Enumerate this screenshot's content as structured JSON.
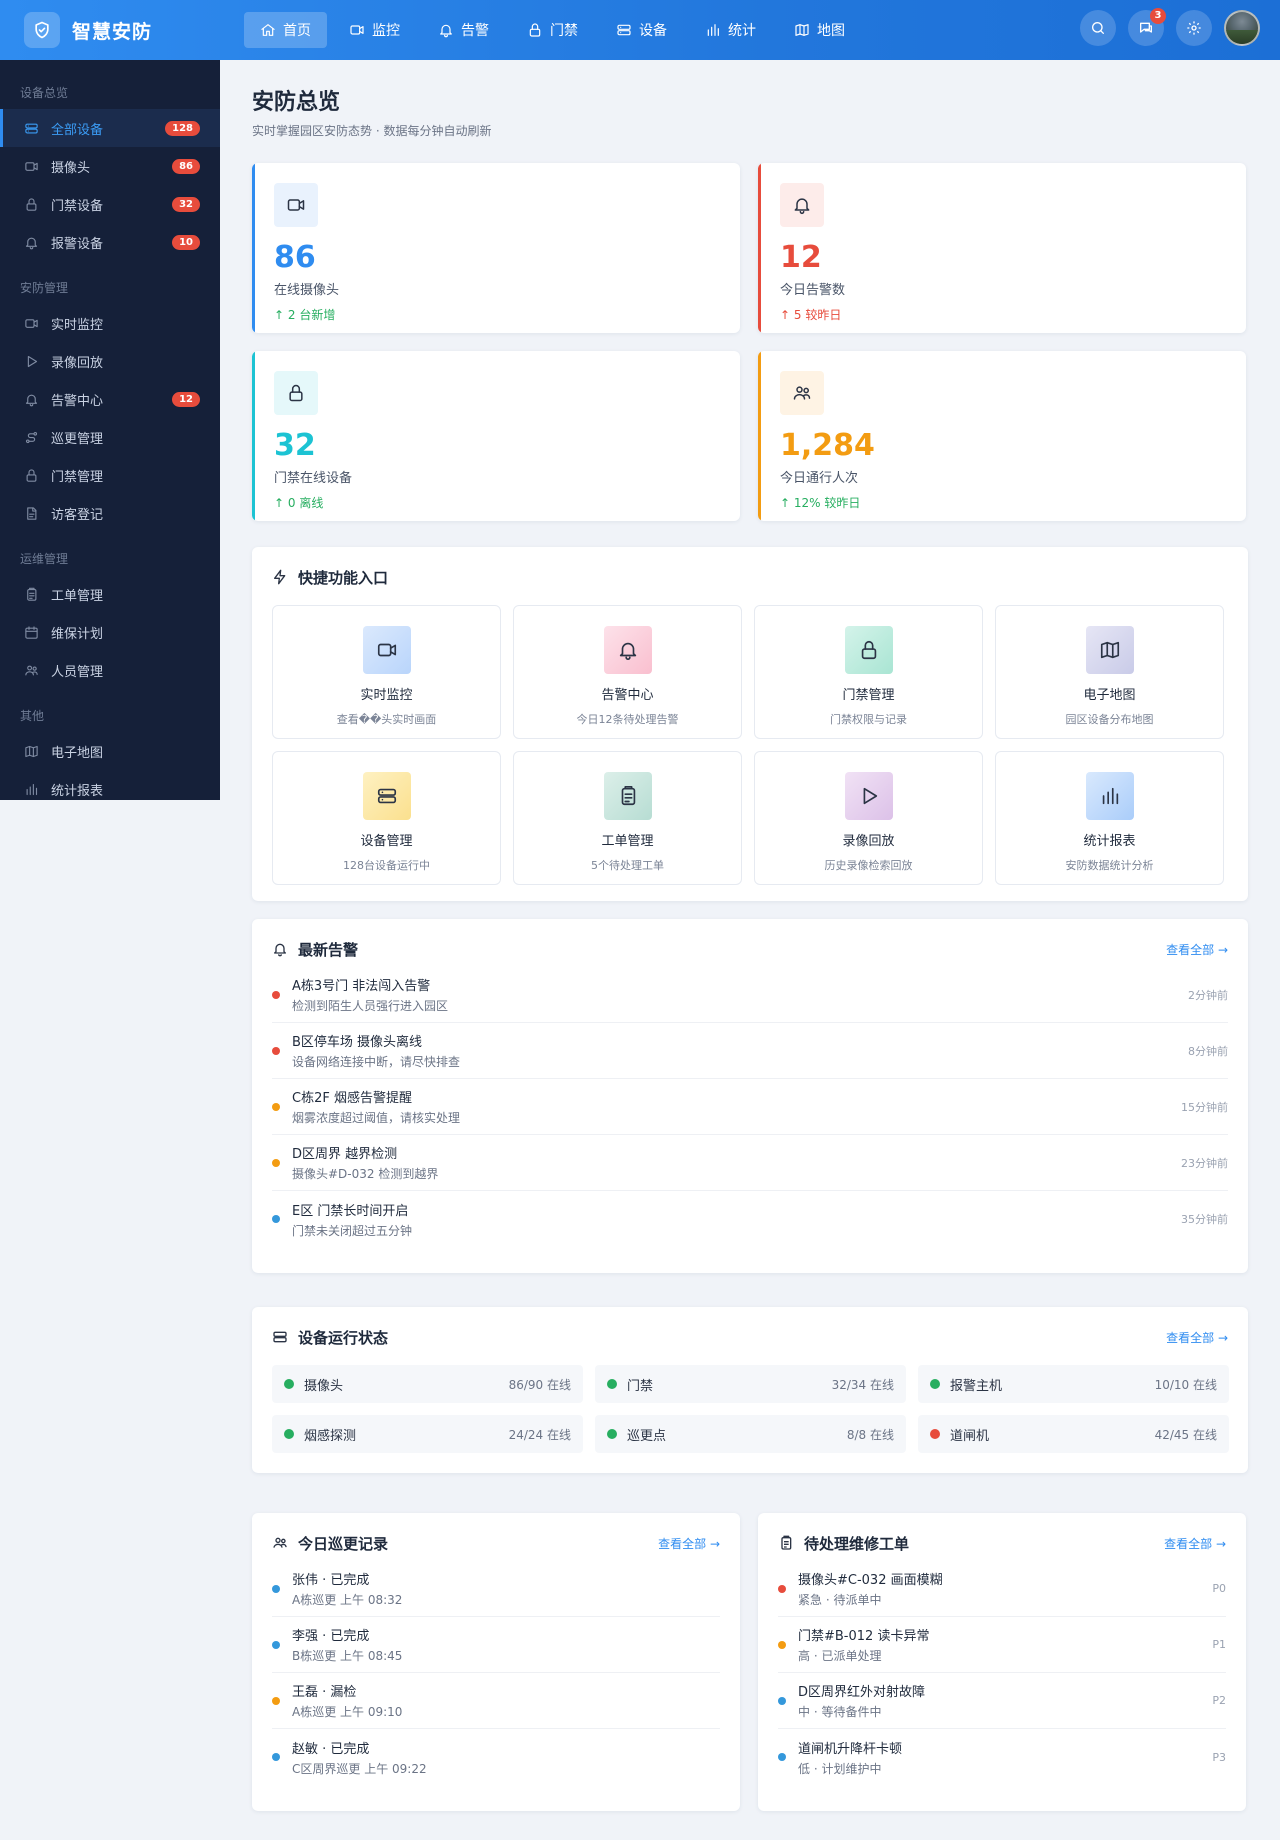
{
  "app": {
    "title": "智慧安防"
  },
  "topnav": [
    {
      "label": "首页",
      "icon": "home-icon",
      "active": true
    },
    {
      "label": "监控",
      "icon": "video-icon"
    },
    {
      "label": "告警",
      "icon": "bell-icon"
    },
    {
      "label": "门禁",
      "icon": "lock-icon"
    },
    {
      "label": "设备",
      "icon": "server-icon"
    },
    {
      "label": "统计",
      "icon": "bar-chart-icon"
    },
    {
      "label": "地图",
      "icon": "map-icon"
    }
  ],
  "header": {
    "notification_count": "3"
  },
  "sidebar": {
    "sections": [
      {
        "title": "设备总览",
        "items": [
          {
            "label": "全部设备",
            "icon": "server-icon",
            "badge": "128",
            "active": true
          },
          {
            "label": "摄像头",
            "icon": "video-icon",
            "badge": "86"
          },
          {
            "label": "门禁设备",
            "icon": "lock-icon",
            "badge": "32"
          },
          {
            "label": "报警设备",
            "icon": "bell-icon",
            "badge": "10"
          }
        ]
      },
      {
        "title": "安防管理",
        "items": [
          {
            "label": "实时监控",
            "icon": "video-icon"
          },
          {
            "label": "录像回放",
            "icon": "play-icon"
          },
          {
            "label": "告警中心",
            "icon": "bell-icon",
            "badge": "12"
          },
          {
            "label": "巡更管理",
            "icon": "route-icon"
          },
          {
            "label": "门禁管理",
            "icon": "lock-icon"
          },
          {
            "label": "访客登记",
            "icon": "document-icon"
          }
        ]
      },
      {
        "title": "运维管理",
        "items": [
          {
            "label": "工单管理",
            "icon": "clipboard-icon"
          },
          {
            "label": "维保计划",
            "icon": "calendar-icon"
          },
          {
            "label": "人员管理",
            "icon": "users-icon"
          }
        ]
      },
      {
        "title": "其他",
        "items": [
          {
            "label": "电子地图",
            "icon": "map-icon"
          },
          {
            "label": "统计报表",
            "icon": "bar-chart-icon"
          }
        ]
      }
    ]
  },
  "page": {
    "title": "安防总览",
    "subtitle": "实时掌握园区安防态势 · 数据每分钟自动刷新"
  },
  "stats": [
    {
      "value": "86",
      "label": "在线摄像头",
      "trend": "↑ 2 台新增",
      "trend_color": "#27ae60",
      "color": "#2f8cf0",
      "bg": "#e9f2fd",
      "icon": "video-icon",
      "variant": "blue"
    },
    {
      "value": "12",
      "label": "今日告警数",
      "trend": "↑ 5 较昨日",
      "trend_color": "#e74c3c",
      "color": "#e74c3c",
      "bg": "#fdecea",
      "icon": "bell-icon",
      "variant": "red"
    },
    {
      "value": "32",
      "label": "门禁在线设备",
      "trend": "↑ 0 离线",
      "trend_color": "#27ae60",
      "color": "#1cc3d3",
      "bg": "#e5f8fa",
      "icon": "lock-icon",
      "variant": "cyan"
    },
    {
      "value": "1,284",
      "label": "今日通行人次",
      "trend": "↑ 12% 较昨日",
      "trend_color": "#27ae60",
      "color": "#f39c12",
      "bg": "#fef3e4",
      "icon": "users-icon",
      "variant": "orange"
    }
  ],
  "quick_access": {
    "title": "快捷功能入口",
    "items": [
      {
        "title": "实时监控",
        "desc": "查看��头实时画面",
        "icon": "video-icon",
        "bg": "linear-gradient(135deg,#dbe9fd,#b9d5fb)"
      },
      {
        "title": "告警中心",
        "desc": "今日12条待处理告警",
        "icon": "bell-icon",
        "bg": "linear-gradient(135deg,#fde2ea,#f9bfcf)"
      },
      {
        "title": "门禁管理",
        "desc": "门禁权限与记录",
        "icon": "lock-icon",
        "bg": "linear-gradient(135deg,#d4f3ea,#a9e5d3)"
      },
      {
        "title": "电子地图",
        "desc": "园区设备分布地图",
        "icon": "map-icon",
        "bg": "linear-gradient(135deg,#e6e6f5,#c9cbe8)"
      },
      {
        "title": "设备管理",
        "desc": "128台设备运行中",
        "icon": "server-icon",
        "bg": "linear-gradient(135deg,#fef1c2,#fbe08e)"
      },
      {
        "title": "工单管理",
        "desc": "5个待处理工单",
        "icon": "clipboard-icon",
        "bg": "linear-gradient(135deg,#dcefe9,#b7ddd3)"
      },
      {
        "title": "录像回放",
        "desc": "历史录像检索回放",
        "icon": "play-icon",
        "bg": "linear-gradient(135deg,#f1e2f5,#dcc1e8)"
      },
      {
        "title": "统计报表",
        "desc": "安防数据统计分析",
        "icon": "bar-chart-icon",
        "bg": "linear-gradient(135deg,#d9e9fd,#aacdfa)"
      }
    ]
  },
  "alerts": {
    "title": "最新告警",
    "more": "查看全部 →",
    "items": [
      {
        "title": "A栋3号门 非法闯入告警",
        "sub": "检测到陌生人员强行进入园区",
        "time": "2分钟前",
        "color": "#e74c3c"
      },
      {
        "title": "B区停车场 摄像头离线",
        "sub": "设备网络连接中断，请尽快排查",
        "time": "8分钟前",
        "color": "#e74c3c"
      },
      {
        "title": "C栋2F 烟感告警提醒",
        "sub": "烟雾浓度超过阈值，请核实处理",
        "time": "15分钟前",
        "color": "#f39c12"
      },
      {
        "title": "D区周界 越界检测",
        "sub": "摄像头#D-032 检测到越界",
        "time": "23分钟前",
        "color": "#f39c12"
      },
      {
        "title": "E区 门禁长时间开启",
        "sub": "门禁未关闭超过五分钟",
        "time": "35分钟前",
        "color": "#3498db"
      }
    ]
  },
  "devices": {
    "title": "设备运行状态",
    "more": "查看全部 →",
    "items": [
      {
        "name": "摄像头",
        "count": "86/90 在线",
        "color": "#27ae60"
      },
      {
        "name": "门禁",
        "count": "32/34 在线",
        "color": "#27ae60"
      },
      {
        "name": "报警主机",
        "count": "10/10 在线",
        "color": "#27ae60"
      },
      {
        "name": "烟感探测",
        "count": "24/24 在线",
        "color": "#27ae60"
      },
      {
        "name": "巡更点",
        "count": "8/8 在线",
        "color": "#27ae60"
      },
      {
        "name": "道闸机",
        "count": "42/45 在线",
        "color": "#e74c3c"
      }
    ]
  },
  "patrol": {
    "title": "今日巡更记录",
    "more": "查看全部 →",
    "items": [
      {
        "title": "张伟 · 已完成",
        "sub": "A栋巡更 上午 08:32",
        "color": "#3498db"
      },
      {
        "title": "李强 · 已完成",
        "sub": "B栋巡更 上午 08:45",
        "color": "#3498db"
      },
      {
        "title": "王磊 · 漏检",
        "sub": "A栋巡更 上午 09:10",
        "color": "#f39c12"
      },
      {
        "title": "赵敏 · 已完成",
        "sub": "C区周界巡更 上午 09:22",
        "color": "#3498db"
      }
    ]
  },
  "workorders": {
    "title": "待处理维修工单",
    "more": "查看全部 →",
    "items": [
      {
        "title": "摄像头#C-032 画面模糊",
        "sub": "紧急 · 待派单中",
        "level": "P0",
        "color": "#e74c3c"
      },
      {
        "title": "门禁#B-012 读卡异常",
        "sub": "高 · 已派单处理",
        "level": "P1",
        "color": "#f39c12"
      },
      {
        "title": "D区周界红外对射故障",
        "sub": "中 · 等待备件中",
        "level": "P2",
        "color": "#3498db"
      },
      {
        "title": "道闸机升降杆卡顿",
        "sub": "低 · 计划维护中",
        "level": "P3",
        "color": "#3498db"
      }
    ]
  }
}
